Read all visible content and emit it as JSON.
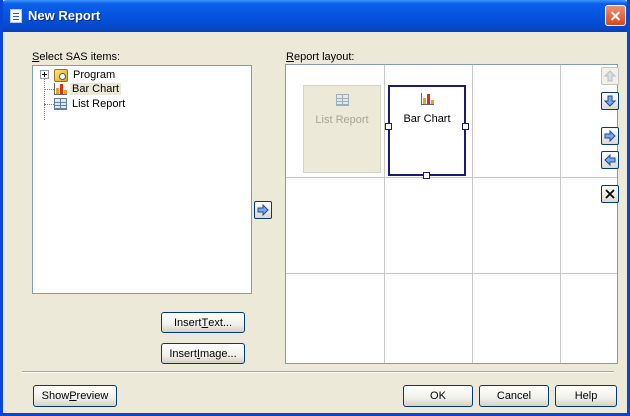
{
  "window": {
    "title": "New Report"
  },
  "left_panel": {
    "label": "Select SAS items:",
    "label_accel": "S",
    "label_rest": "elect SAS items:",
    "tree": [
      {
        "label": "Program",
        "icon": "program-icon"
      },
      {
        "label": "Bar Chart",
        "icon": "bar-chart-icon",
        "selected": true
      },
      {
        "label": "List Report",
        "icon": "list-report-icon"
      }
    ]
  },
  "right_panel": {
    "label_accel": "R",
    "label_rest": "eport layout:",
    "cells": [
      {
        "label": "List Report",
        "icon": "list-report-icon",
        "state": "disabled"
      },
      {
        "label": "Bar Chart",
        "icon": "bar-chart-icon",
        "state": "selected"
      }
    ]
  },
  "buttons": {
    "insert_text_pre": "Insert ",
    "insert_text_accel": "T",
    "insert_text_post": "ext...",
    "insert_image_pre": "Insert ",
    "insert_image_accel": "I",
    "insert_image_post": "mage...",
    "show_preview_pre": "Show ",
    "show_preview_accel": "P",
    "show_preview_post": "review",
    "ok": "OK",
    "cancel": "Cancel",
    "help": "Help"
  },
  "colors": {
    "title_bar": "#0554e0",
    "dialog_bg": "#ece9d8",
    "selection_border": "#1c1c6c",
    "bar_red": "#d83020",
    "bar_orange": "#f0a020"
  }
}
